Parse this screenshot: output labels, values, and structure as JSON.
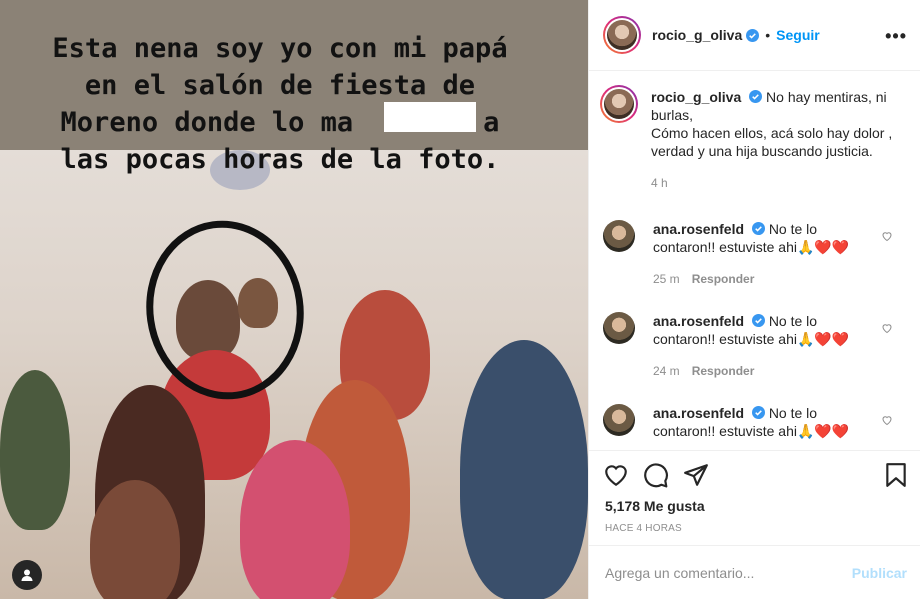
{
  "story": {
    "caption_lines": [
      "Esta nena soy yo con mi papá",
      "en el salón de fiesta de",
      "Moreno donde lo ma        a",
      "las pocas horas de la foto."
    ]
  },
  "header": {
    "username": "rocio_g_oliva",
    "dot": "•",
    "follow_label": "Seguir",
    "more_label": "•••"
  },
  "post": {
    "username": "rocio_g_oliva",
    "caption": "No hay mentiras, ni burlas,",
    "caption_line2": "Cómo hacen ellos, acá solo hay dolor ,",
    "caption_line3": "verdad y una hija buscando justicia.",
    "time": "4 h"
  },
  "comments": [
    {
      "username": "ana.rosenfeld",
      "text": "No te lo contaron!! estuviste ahi🙏❤️❤️",
      "time": "25 m",
      "reply_label": "Responder"
    },
    {
      "username": "ana.rosenfeld",
      "text": "No te lo contaron!! estuviste ahi🙏❤️❤️",
      "time": "24 m",
      "reply_label": "Responder"
    },
    {
      "username": "ana.rosenfeld",
      "text": "No te lo contaron!! estuviste ahi🙏❤️❤️",
      "time": "",
      "reply_label": ""
    }
  ],
  "actions": {
    "likes": "5,178 Me gusta",
    "posted": "HACE 4 HORAS",
    "icons": [
      "heart-icon",
      "comment-icon",
      "share-icon",
      "bookmark-icon"
    ]
  },
  "add_comment": {
    "placeholder": "Agrega un comentario...",
    "publish_label": "Publicar"
  },
  "colors": {
    "link": "#0095f6",
    "publish_disabled": "#b2dffc",
    "muted": "#8e8e8e",
    "heart": "#ed4956"
  }
}
